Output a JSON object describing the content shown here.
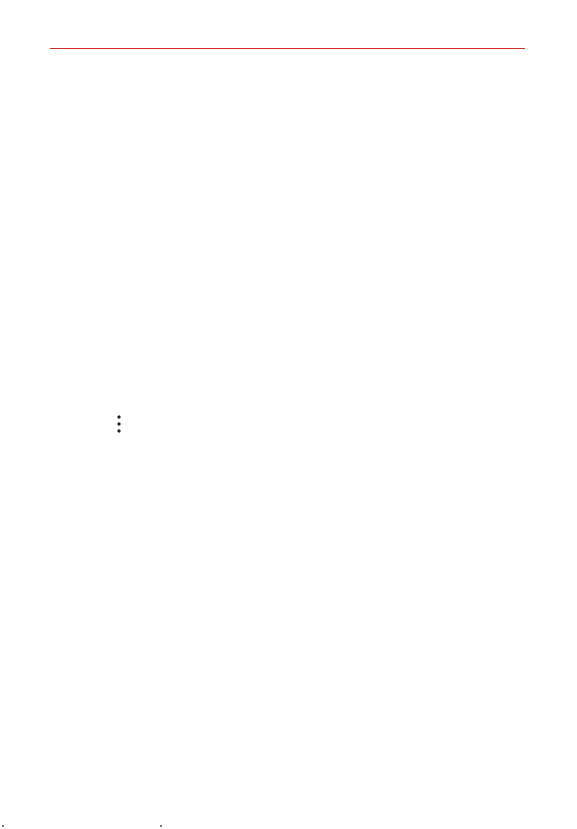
{
  "page": {
    "header_rule_color": "#d32f2f",
    "background": "#ffffff"
  },
  "icons": {
    "more": "more-vertical-icon"
  }
}
